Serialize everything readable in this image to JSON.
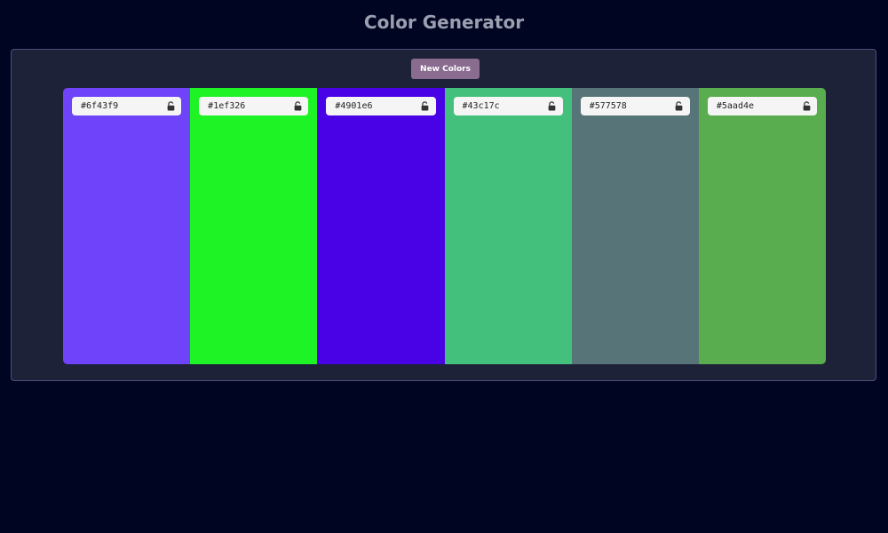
{
  "header": {
    "title": "Color Generator"
  },
  "toolbar": {
    "new_colors_label": "New Colors",
    "button_color": "#8a6c91"
  },
  "palette": [
    {
      "hex": "#6f43f9",
      "color": "#6f43f9",
      "lock_icon": "unlocked-lock-icon",
      "locked": false
    },
    {
      "hex": "#1ef326",
      "color": "#1ef326",
      "lock_icon": "unlocked-lock-icon",
      "locked": false
    },
    {
      "hex": "#4901e6",
      "color": "#4901e6",
      "lock_icon": "unlocked-lock-icon",
      "locked": false
    },
    {
      "hex": "#43c17c",
      "color": "#43c17c",
      "lock_icon": "unlocked-lock-icon",
      "locked": false
    },
    {
      "hex": "#577578",
      "color": "#577578",
      "lock_icon": "unlocked-lock-icon",
      "locked": false
    },
    {
      "hex": "#5aad4e",
      "color": "#5aad4e",
      "lock_icon": "unlocked-lock-icon",
      "locked": false
    }
  ]
}
